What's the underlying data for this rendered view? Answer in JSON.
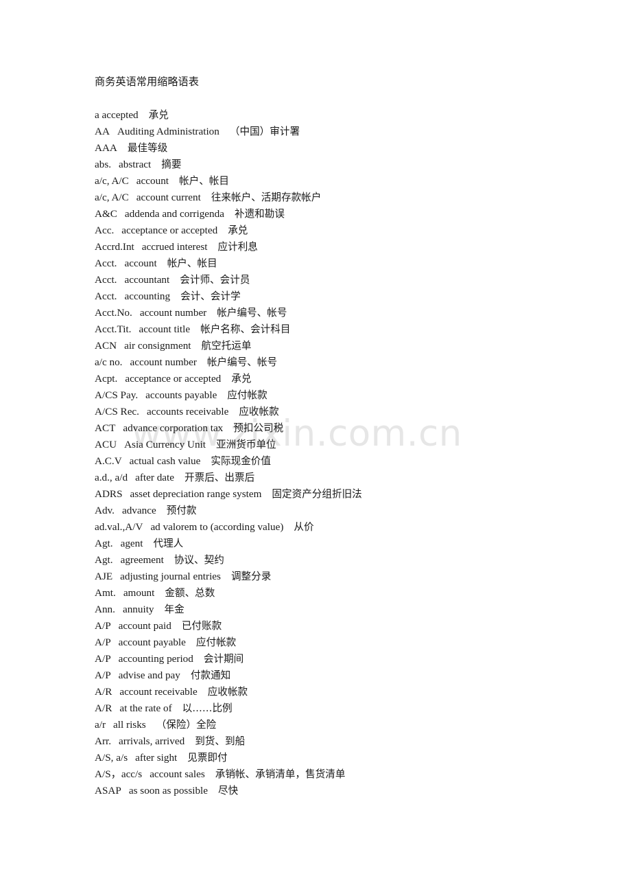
{
  "document": {
    "title": "商务英语常用缩略语表",
    "watermark": "www.zixin.com.cn",
    "watermark_color": "#e6e6e6",
    "text_color": "#1a1a1a",
    "background_color": "#ffffff"
  },
  "entries": [
    {
      "abbr": "a accepted",
      "english": "",
      "chinese": "承兑"
    },
    {
      "abbr": "AA",
      "english": "Auditing Administration",
      "chinese": "（中国）审计署"
    },
    {
      "abbr": "AAA",
      "english": "",
      "chinese": "最佳等级"
    },
    {
      "abbr": "abs.",
      "english": "abstract",
      "chinese": "摘要"
    },
    {
      "abbr": "a/c, A/C",
      "english": "account",
      "chinese": "帐户、帐目"
    },
    {
      "abbr": "a/c, A/C",
      "english": "account current",
      "chinese": "往来帐户、活期存款帐户"
    },
    {
      "abbr": "A&C",
      "english": "addenda and corrigenda",
      "chinese": "补遗和勘误"
    },
    {
      "abbr": "Acc.",
      "english": "acceptance or accepted",
      "chinese": "承兑"
    },
    {
      "abbr": "Accrd.Int",
      "english": "accrued interest",
      "chinese": "应计利息"
    },
    {
      "abbr": "Acct.",
      "english": "account",
      "chinese": "帐户、帐目"
    },
    {
      "abbr": "Acct.",
      "english": "accountant",
      "chinese": "会计师、会计员"
    },
    {
      "abbr": "Acct.",
      "english": "accounting",
      "chinese": "会计、会计学"
    },
    {
      "abbr": "Acct.No.",
      "english": "account number",
      "chinese": "帐户编号、帐号"
    },
    {
      "abbr": "Acct.Tit.",
      "english": "account title",
      "chinese": "帐户名称、会计科目"
    },
    {
      "abbr": "ACN",
      "english": "air consignment",
      "chinese": "航空托运单"
    },
    {
      "abbr": "a/c no.",
      "english": "account number",
      "chinese": "帐户编号、帐号"
    },
    {
      "abbr": "Acpt.",
      "english": "acceptance or accepted",
      "chinese": "承兑"
    },
    {
      "abbr": "A/CS Pay.",
      "english": "accounts payable",
      "chinese": "应付帐款"
    },
    {
      "abbr": "A/CS Rec.",
      "english": "accounts receivable",
      "chinese": "应收帐款"
    },
    {
      "abbr": "ACT",
      "english": "advance corporation tax",
      "chinese": "预扣公司税"
    },
    {
      "abbr": "ACU",
      "english": "Asia Currency Unit",
      "chinese": "亚洲货币单位"
    },
    {
      "abbr": "A.C.V",
      "english": "actual cash value",
      "chinese": "实际现金价值"
    },
    {
      "abbr": "a.d., a/d",
      "english": "after date",
      "chinese": "开票后、出票后"
    },
    {
      "abbr": "ADRS",
      "english": "asset depreciation range system",
      "chinese": "固定资产分组折旧法"
    },
    {
      "abbr": "Adv.",
      "english": "advance",
      "chinese": "预付款"
    },
    {
      "abbr": "ad.val.,A/V",
      "english": "ad valorem to (according value)",
      "chinese": "从价"
    },
    {
      "abbr": "Agt.",
      "english": "agent",
      "chinese": "代理人"
    },
    {
      "abbr": "Agt.",
      "english": "agreement",
      "chinese": "协议、契约"
    },
    {
      "abbr": "AJE",
      "english": "adjusting journal entries",
      "chinese": "调整分录"
    },
    {
      "abbr": "Amt.",
      "english": "amount",
      "chinese": "金额、总数"
    },
    {
      "abbr": "Ann.",
      "english": "annuity",
      "chinese": "年金"
    },
    {
      "abbr": "A/P",
      "english": "account paid",
      "chinese": "已付账款"
    },
    {
      "abbr": "A/P",
      "english": "account payable",
      "chinese": "应付帐款"
    },
    {
      "abbr": "A/P",
      "english": "accounting period",
      "chinese": "会计期间"
    },
    {
      "abbr": "A/P",
      "english": "advise and pay",
      "chinese": "付款通知"
    },
    {
      "abbr": "A/R",
      "english": "account receivable",
      "chinese": "应收帐款"
    },
    {
      "abbr": "A/R",
      "english": "at the rate of",
      "chinese": "以……比例"
    },
    {
      "abbr": "a/r",
      "english": "all risks",
      "chinese": "（保险）全险"
    },
    {
      "abbr": "Arr.",
      "english": "arrivals, arrived",
      "chinese": "到货、到船"
    },
    {
      "abbr": "A/S, a/s",
      "english": "after sight",
      "chinese": "见票即付"
    },
    {
      "abbr": "A/S，acc/s",
      "english": "account sales",
      "chinese": "承销帐、承销清单，售货清单"
    },
    {
      "abbr": "ASAP",
      "english": "as soon as possible",
      "chinese": "尽快"
    }
  ]
}
